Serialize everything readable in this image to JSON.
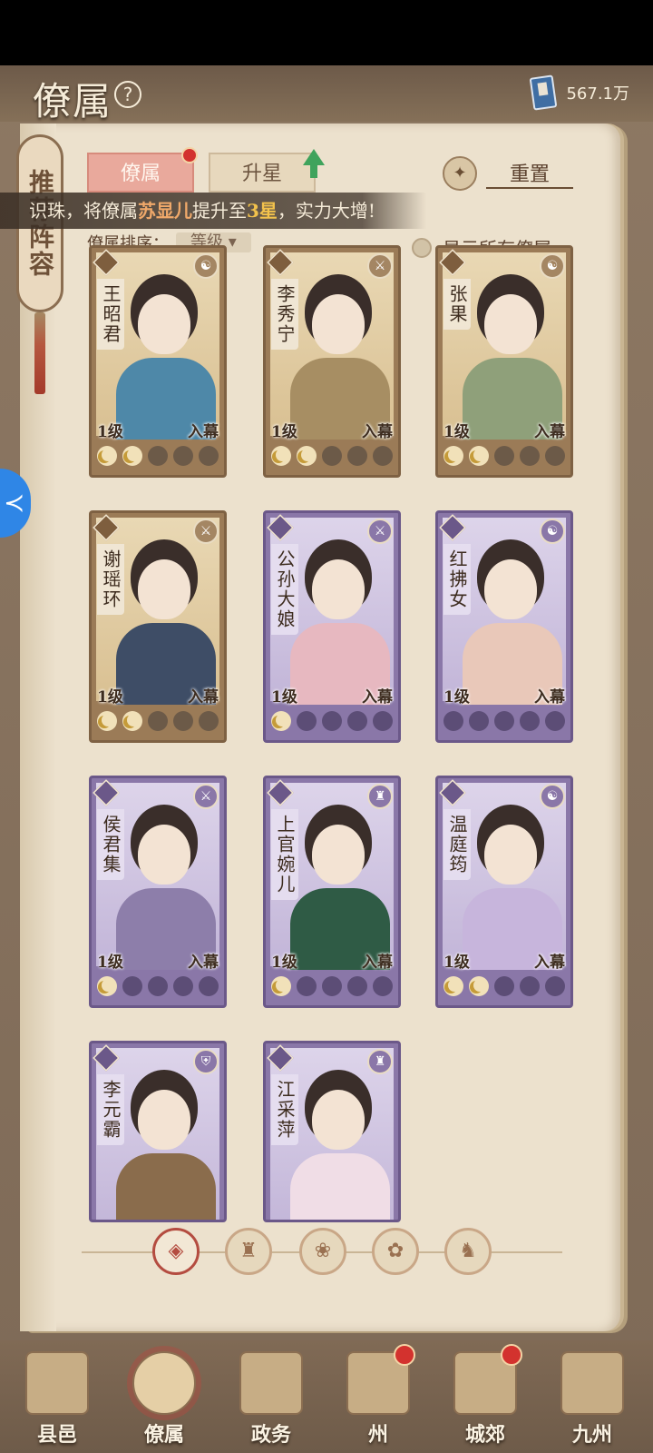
{
  "header": {
    "title": "僚属",
    "help_icon": "?",
    "currency_value": "567.1万"
  },
  "side_tag": "推荐阵容",
  "tabs": [
    {
      "label": "僚属",
      "active": true,
      "has_red_dot": true
    },
    {
      "label": "升星",
      "active": false,
      "has_up_arrow": true
    }
  ],
  "reset_label": "重置",
  "banner": {
    "prefix": "识珠，将僚属",
    "name": "苏显儿",
    "middle": "提升至",
    "star": "3星",
    "suffix": "，实力大增!"
  },
  "sort": {
    "label": "僚属排序：",
    "value": "等级"
  },
  "show_all_label": "显示所有僚属",
  "cards": [
    {
      "name": "王昭君",
      "level": "1级",
      "status": "入幕",
      "rarity": "gold",
      "stars_on": 2,
      "type_icon": "yin-yang-icon",
      "body_color": "#4e88a8"
    },
    {
      "name": "李秀宁",
      "level": "1级",
      "status": "入幕",
      "rarity": "gold",
      "stars_on": 2,
      "type_icon": "sword-icon",
      "body_color": "#a78e63"
    },
    {
      "name": "张果",
      "level": "1级",
      "status": "入幕",
      "rarity": "gold",
      "stars_on": 2,
      "type_icon": "yin-yang-icon",
      "body_color": "#8fa07a"
    },
    {
      "name": "谢瑶环",
      "level": "1级",
      "status": "入幕",
      "rarity": "gold",
      "stars_on": 2,
      "type_icon": "sword-icon",
      "body_color": "#3e4d66"
    },
    {
      "name": "公孙大娘",
      "level": "1级",
      "status": "入幕",
      "rarity": "purple",
      "stars_on": 1,
      "type_icon": "sword-icon",
      "body_color": "#e7b8c0"
    },
    {
      "name": "红拂女",
      "level": "1级",
      "status": "入幕",
      "rarity": "purple",
      "stars_on": 0,
      "type_icon": "yin-yang-icon",
      "body_color": "#e9c8b9"
    },
    {
      "name": "侯君集",
      "level": "1级",
      "status": "入幕",
      "rarity": "purple",
      "stars_on": 1,
      "type_icon": "sword-icon",
      "body_color": "#8d7eaa"
    },
    {
      "name": "上官婉儿",
      "level": "1级",
      "status": "入幕",
      "rarity": "purple",
      "stars_on": 1,
      "type_icon": "hat-icon",
      "body_color": "#2f5b45"
    },
    {
      "name": "温庭筠",
      "level": "1级",
      "status": "入幕",
      "rarity": "purple",
      "stars_on": 2,
      "type_icon": "yin-yang-icon",
      "body_color": "#c7b5dc"
    },
    {
      "name": "李元霸",
      "level": "",
      "status": "",
      "rarity": "purple",
      "stars_on": 0,
      "type_icon": "shield-icon",
      "body_color": "#8a6c4c"
    },
    {
      "name": "江采萍",
      "level": "",
      "status": "",
      "rarity": "purple",
      "stars_on": 0,
      "type_icon": "hat-icon",
      "body_color": "#f0dde6"
    }
  ],
  "filters": [
    {
      "name": "all-filter-icon",
      "glyph": "◈",
      "active": true
    },
    {
      "name": "hat-filter-icon",
      "glyph": "♜",
      "active": false
    },
    {
      "name": "cat-filter-icon",
      "glyph": "❀",
      "active": false
    },
    {
      "name": "fan-filter-icon",
      "glyph": "✿",
      "active": false
    },
    {
      "name": "lion-filter-icon",
      "glyph": "♞",
      "active": false
    }
  ],
  "bottom_nav": [
    {
      "label": "县邑",
      "active": false,
      "dot": false
    },
    {
      "label": "僚属",
      "active": true,
      "dot": false
    },
    {
      "label": "政务",
      "active": false,
      "dot": false
    },
    {
      "label": "州",
      "active": false,
      "dot": true
    },
    {
      "label": "城郊",
      "active": false,
      "dot": true
    },
    {
      "label": "九州",
      "active": false,
      "dot": false
    }
  ]
}
